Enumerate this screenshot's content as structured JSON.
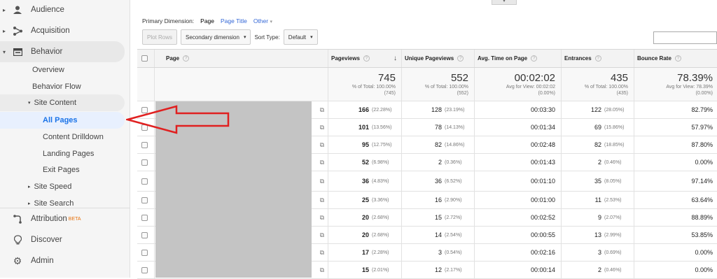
{
  "sidebar": {
    "top_items": [
      {
        "label": "Audience",
        "icon": "person-icon"
      },
      {
        "label": "Acquisition",
        "icon": "acquisition-icon"
      },
      {
        "label": "Behavior",
        "icon": "behavior-icon"
      }
    ],
    "behavior_items": [
      "Overview",
      "Behavior Flow"
    ],
    "site_content": {
      "label": "Site Content",
      "items": [
        "All Pages",
        "Content Drilldown",
        "Landing Pages",
        "Exit Pages"
      ]
    },
    "collapsed_items": [
      "Site Speed",
      "Site Search"
    ],
    "bottom_items": [
      {
        "label": "Attribution",
        "badge": "BETA",
        "icon": "attribution-icon"
      },
      {
        "label": "Discover",
        "icon": "lightbulb-icon"
      },
      {
        "label": "Admin",
        "icon": "gear-icon"
      }
    ],
    "selected": "All Pages"
  },
  "dimension_bar": {
    "label": "Primary Dimension:",
    "active": "Page",
    "links": [
      "Page Title",
      "Other"
    ]
  },
  "toolbar": {
    "plot_rows": "Plot Rows",
    "secondary_dimension": "Secondary dimension",
    "sort_type_label": "Sort Type:",
    "sort_type_value": "Default"
  },
  "table": {
    "columns": [
      "Page",
      "Pageviews",
      "Unique Pageviews",
      "Avg. Time on Page",
      "Entrances",
      "Bounce Rate"
    ],
    "totals": [
      {
        "value": "745",
        "sub1": "% of Total: 100.00%",
        "sub2": "(745)"
      },
      {
        "value": "552",
        "sub1": "% of Total: 100.00%",
        "sub2": "(552)"
      },
      {
        "value": "00:02:02",
        "sub1": "Avg for View: 00:02:02",
        "sub2": "(0.00%)"
      },
      {
        "value": "435",
        "sub1": "% of Total: 100.00%",
        "sub2": "(435)"
      },
      {
        "value": "78.39%",
        "sub1": "Avg for View: 78.39%",
        "sub2": "(0.00%)"
      }
    ],
    "rows": [
      {
        "pv": "166",
        "pv_pct": "(22.28%)",
        "upv": "128",
        "upv_pct": "(23.19%)",
        "time": "00:03:30",
        "ent": "122",
        "ent_pct": "(28.05%)",
        "bounce": "82.79%"
      },
      {
        "pv": "101",
        "pv_pct": "(13.56%)",
        "upv": "78",
        "upv_pct": "(14.13%)",
        "time": "00:01:34",
        "ent": "69",
        "ent_pct": "(15.86%)",
        "bounce": "57.97%"
      },
      {
        "pv": "95",
        "pv_pct": "(12.75%)",
        "upv": "82",
        "upv_pct": "(14.86%)",
        "time": "00:02:48",
        "ent": "82",
        "ent_pct": "(18.85%)",
        "bounce": "87.80%"
      },
      {
        "pv": "52",
        "pv_pct": "(6.98%)",
        "upv": "2",
        "upv_pct": "(0.36%)",
        "time": "00:01:43",
        "ent": "2",
        "ent_pct": "(0.46%)",
        "bounce": "0.00%"
      },
      {
        "pv": "36",
        "pv_pct": "(4.83%)",
        "upv": "36",
        "upv_pct": "(6.52%)",
        "time": "00:01:10",
        "ent": "35",
        "ent_pct": "(8.05%)",
        "bounce": "97.14%"
      },
      {
        "pv": "25",
        "pv_pct": "(3.36%)",
        "upv": "16",
        "upv_pct": "(2.90%)",
        "time": "00:01:00",
        "ent": "11",
        "ent_pct": "(2.53%)",
        "bounce": "63.64%"
      },
      {
        "pv": "20",
        "pv_pct": "(2.68%)",
        "upv": "15",
        "upv_pct": "(2.72%)",
        "time": "00:02:52",
        "ent": "9",
        "ent_pct": "(2.07%)",
        "bounce": "88.89%"
      },
      {
        "pv": "20",
        "pv_pct": "(2.68%)",
        "upv": "14",
        "upv_pct": "(2.54%)",
        "time": "00:00:55",
        "ent": "13",
        "ent_pct": "(2.99%)",
        "bounce": "53.85%"
      },
      {
        "pv": "17",
        "pv_pct": "(2.28%)",
        "upv": "3",
        "upv_pct": "(0.54%)",
        "time": "00:02:16",
        "ent": "3",
        "ent_pct": "(0.69%)",
        "bounce": "0.00%"
      },
      {
        "pv": "15",
        "pv_pct": "(2.01%)",
        "upv": "12",
        "upv_pct": "(2.17%)",
        "time": "00:00:14",
        "ent": "2",
        "ent_pct": "(0.46%)",
        "bounce": "0.00%"
      }
    ]
  },
  "colors": {
    "accent": "#1a73e8",
    "selected_bg": "#e8f0fe",
    "arrow": "#e02020"
  }
}
